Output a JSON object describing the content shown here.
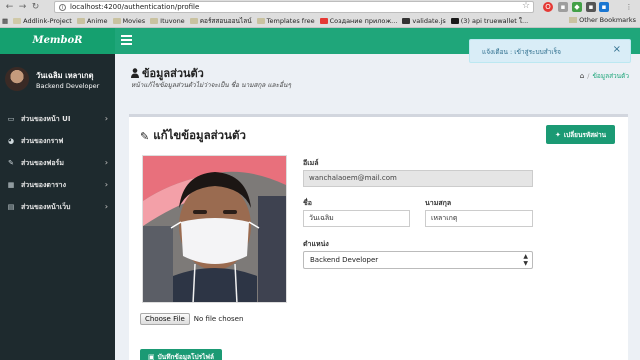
{
  "browser": {
    "url": "localhost:4200/authentication/profile",
    "bookmarks": [
      {
        "label": "Addlink-Project",
        "color": "#d0c9a8"
      },
      {
        "label": "Anime",
        "color": "#c9c2a0"
      },
      {
        "label": "Movies",
        "color": "#c9c2a0"
      },
      {
        "label": "Ituvone",
        "color": "#c9c2a0"
      },
      {
        "label": "คอร์สสอนออนไลน์",
        "color": "#c9c2a0"
      },
      {
        "label": "Templates free",
        "color": "#c9c2a0"
      },
      {
        "label": "Создание прилож...",
        "color": "#e53935"
      },
      {
        "label": "validate.js",
        "color": "#333333"
      },
      {
        "label": "(3) api truewallet ใ...",
        "color": "#1a1a1a"
      }
    ],
    "other_bookmarks": "Other Bookmarks"
  },
  "header": {
    "logo": "MemboR",
    "toast": "แจ้งเตือน : เข้าสู่ระบบสำเร็จ",
    "toast_close": "×"
  },
  "user": {
    "name": "วันเฉลิม เหลาเกตุ",
    "role": "Backend Developer"
  },
  "sidebar": {
    "items": [
      {
        "label": "ส่วนของหน้า UI",
        "icon": "laptop-icon",
        "glyph": "▭",
        "has_caret": true
      },
      {
        "label": "ส่วนของกราฟ",
        "icon": "pie-chart-icon",
        "glyph": "◕",
        "has_caret": false
      },
      {
        "label": "ส่วนของฟอร์ม",
        "icon": "edit-icon",
        "glyph": "✎",
        "has_caret": true
      },
      {
        "label": "ส่วนของตาราง",
        "icon": "table-icon",
        "glyph": "▦",
        "has_caret": true
      },
      {
        "label": "ส่วนของหน้าเว็บ",
        "icon": "file-icon",
        "glyph": "▤",
        "has_caret": true
      }
    ]
  },
  "page": {
    "title": "ข้อมูลส่วนตัว",
    "subtitle": "หน้าแก้ไขข้อมูลส่วนตัวไม่ว่าจะเป็น ชื่อ นามสกุล และอื่นๆ",
    "breadcrumb": "ข้อมูลส่วนตัว"
  },
  "form": {
    "title": "แก้ไขข้อมูลส่วนตัว",
    "change_password": "เปลี่ยนรหัสผ่าน",
    "email_label": "อีเมล์",
    "email": "wanchalaoem@mail.com",
    "first_name_label": "ชื่อ",
    "first_name": "วันเฉลิม",
    "last_name_label": "นามสกุล",
    "last_name": "เหลาเกตุ",
    "position_label": "ตำแหน่ง",
    "position": "Backend Developer",
    "file_button": "Choose File",
    "file_status": "No file chosen",
    "save_button": "บันทึกข้อมูลโปรไฟล์"
  }
}
